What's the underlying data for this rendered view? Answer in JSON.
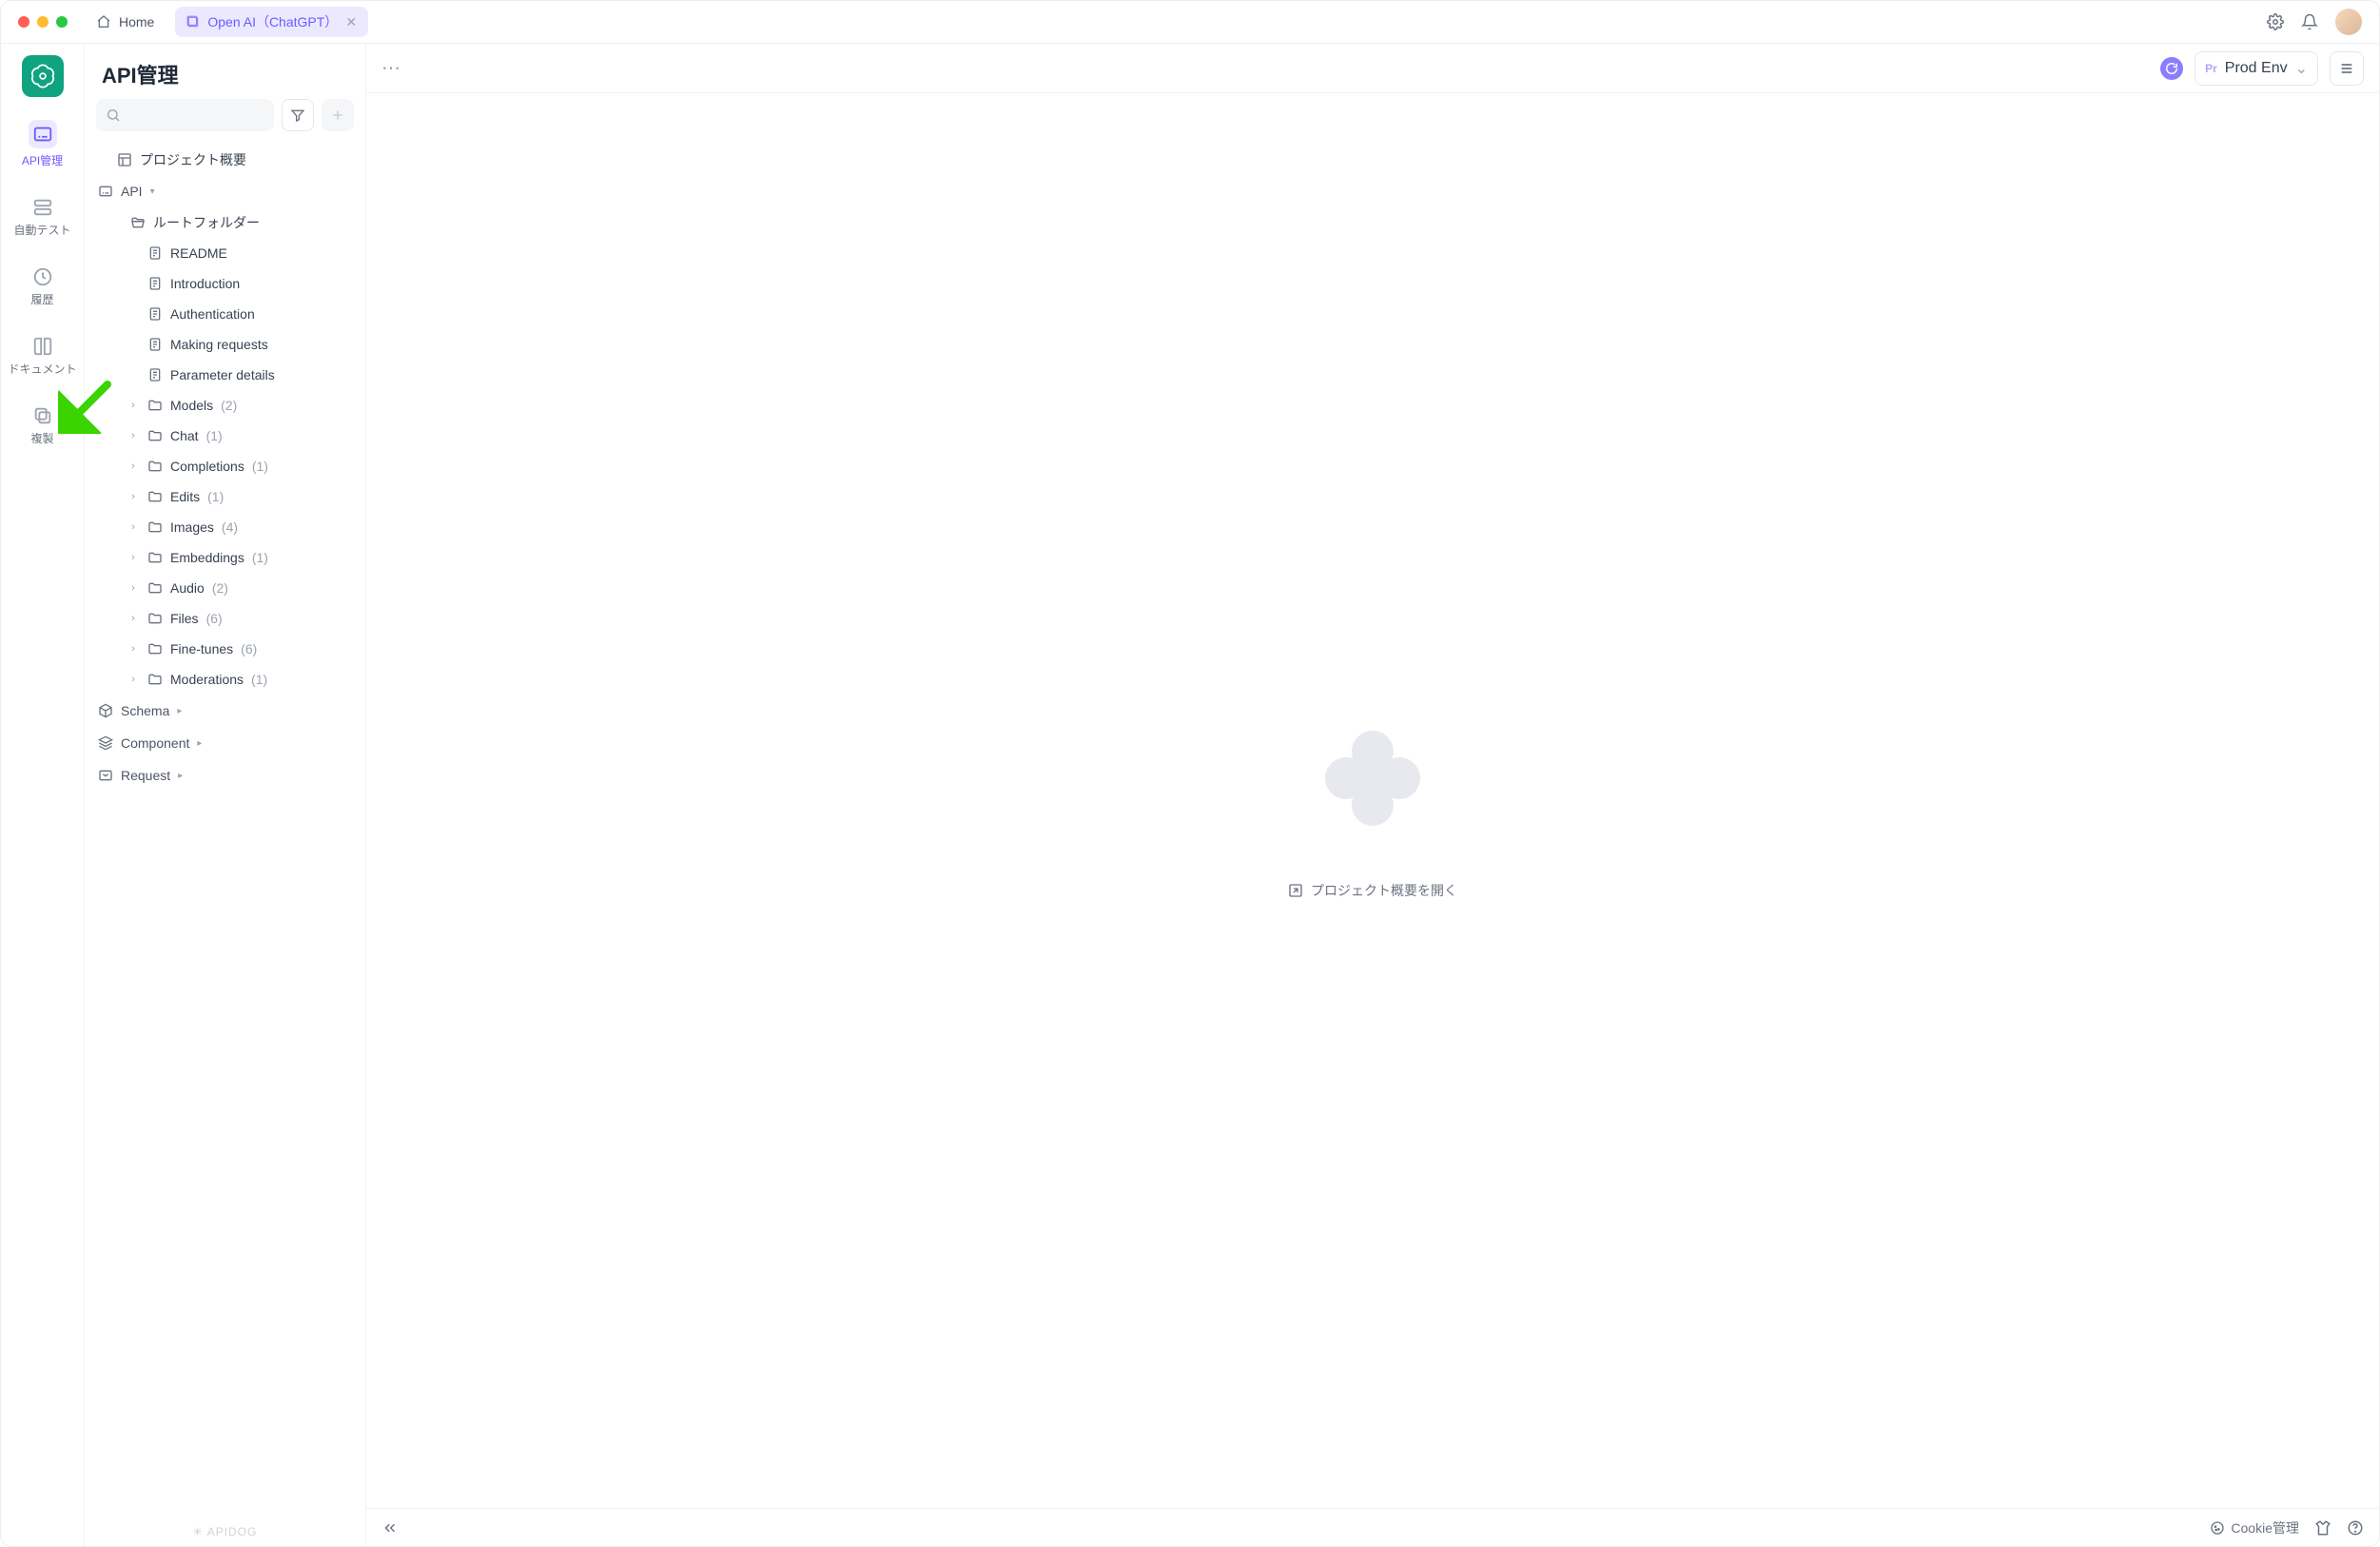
{
  "titlebar": {
    "home_label": "Home",
    "active_tab_label": "Open AI（ChatGPT）"
  },
  "rail": {
    "items": [
      {
        "label": "API管理"
      },
      {
        "label": "自動テスト"
      },
      {
        "label": "履歴"
      },
      {
        "label": "ドキュメント"
      },
      {
        "label": "複製"
      }
    ]
  },
  "sidebar": {
    "title": "API管理",
    "overview_label": "プロジェクト概要",
    "api_label": "API",
    "root_folder_label": "ルートフォルダー",
    "docs": [
      {
        "label": "README"
      },
      {
        "label": "Introduction"
      },
      {
        "label": "Authentication"
      },
      {
        "label": "Making requests"
      },
      {
        "label": "Parameter details"
      }
    ],
    "folders": [
      {
        "label": "Models",
        "count": "(2)"
      },
      {
        "label": "Chat",
        "count": "(1)"
      },
      {
        "label": "Completions",
        "count": "(1)"
      },
      {
        "label": "Edits",
        "count": "(1)"
      },
      {
        "label": "Images",
        "count": "(4)"
      },
      {
        "label": "Embeddings",
        "count": "(1)"
      },
      {
        "label": "Audio",
        "count": "(2)"
      },
      {
        "label": "Files",
        "count": "(6)"
      },
      {
        "label": "Fine-tunes",
        "count": "(6)"
      },
      {
        "label": "Moderations",
        "count": "(1)"
      }
    ],
    "sections": [
      {
        "label": "Schema"
      },
      {
        "label": "Component"
      },
      {
        "label": "Request"
      }
    ],
    "footer_brand": "APIDOG"
  },
  "main": {
    "env_prefix": "Pr",
    "env_label": "Prod Env",
    "open_overview_label": "プロジェクト概要を開く"
  },
  "footer": {
    "cookie_label": "Cookie管理"
  }
}
